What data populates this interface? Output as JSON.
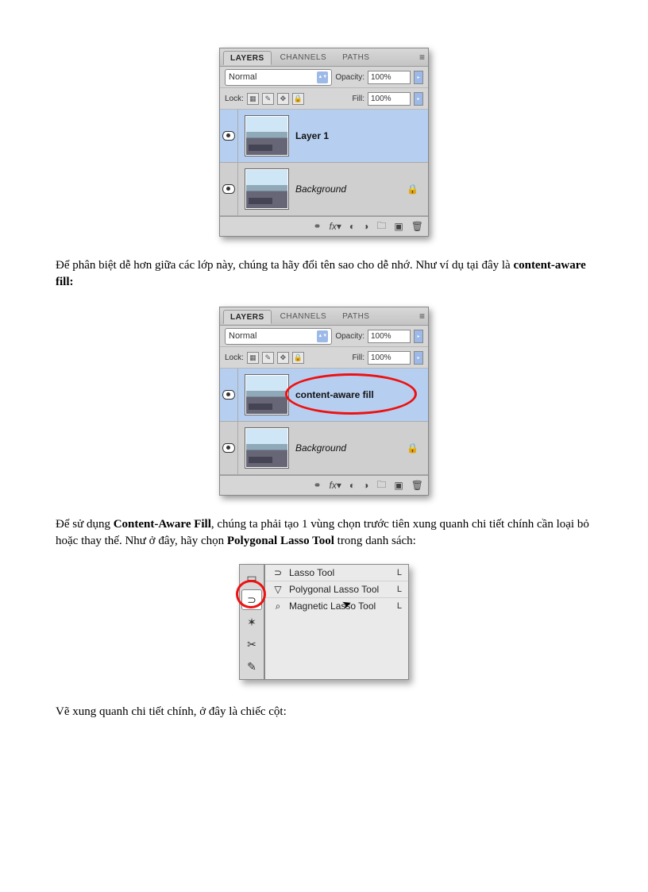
{
  "panel": {
    "tabs": {
      "t0": "LAYERS",
      "t1": "CHANNELS",
      "t2": "PATHS"
    },
    "blend_mode": "Normal",
    "opacity_label": "Opacity:",
    "opacity_value": "100%",
    "lock_label": "Lock:",
    "fill_label": "Fill:",
    "fill_value": "100%",
    "layer1": "Layer 1",
    "background": "Background",
    "renamed": "content-aware fill"
  },
  "text": {
    "p1a": "Để phân biệt dễ hơn giữa các lớp này, chúng ta hãy đổi tên sao cho dễ nhớ. Như ví dụ tại đây là ",
    "p1b": "content-aware fill:",
    "p2a": "Để sử dụng ",
    "p2b": "Content-Aware Fill",
    "p2c": ", chúng ta phải tạo 1 vùng chọn trước tiên xung quanh chi tiết chính cần loại bỏ hoặc thay thế. Như ở đây, hãy chọn ",
    "p2d": "Polygonal Lasso Tool",
    "p2e": " trong danh sách:",
    "p3": "Vẽ xung quanh chi tiết chính, ở đây là chiếc cột:"
  },
  "tools": {
    "lasso": "Lasso Tool",
    "poly": "Polygonal Lasso Tool",
    "mag": "Magnetic Lasso Tool",
    "short": "L"
  }
}
